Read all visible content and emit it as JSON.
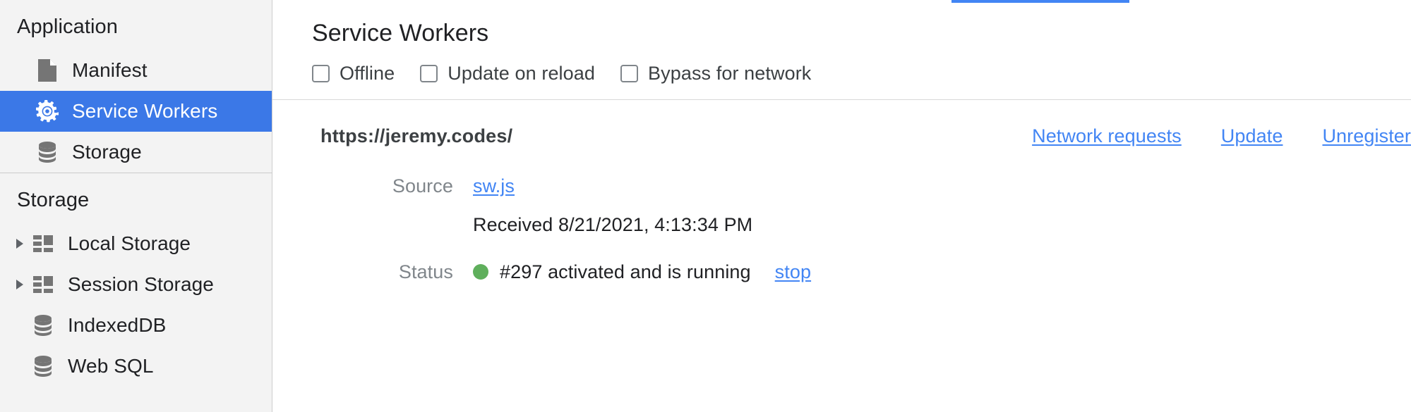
{
  "sidebar": {
    "sections": [
      {
        "heading": "Application",
        "items": [
          {
            "label": "Manifest",
            "icon": "document-icon",
            "selected": false,
            "expandable": false
          },
          {
            "label": "Service Workers",
            "icon": "gear-icon",
            "selected": true,
            "expandable": false
          },
          {
            "label": "Storage",
            "icon": "database-icon",
            "selected": false,
            "expandable": false
          }
        ]
      },
      {
        "heading": "Storage",
        "items": [
          {
            "label": "Local Storage",
            "icon": "table-icon",
            "selected": false,
            "expandable": true
          },
          {
            "label": "Session Storage",
            "icon": "table-icon",
            "selected": false,
            "expandable": true
          },
          {
            "label": "IndexedDB",
            "icon": "database-icon",
            "selected": false,
            "expandable": false
          },
          {
            "label": "Web SQL",
            "icon": "database-icon",
            "selected": false,
            "expandable": false
          }
        ]
      }
    ]
  },
  "panel": {
    "title": "Service Workers",
    "options": [
      {
        "label": "Offline",
        "checked": false
      },
      {
        "label": "Update on reload",
        "checked": false
      },
      {
        "label": "Bypass for network",
        "checked": false
      }
    ],
    "registration": {
      "scope": "https://jeremy.codes/",
      "actions": [
        {
          "label": "Network requests"
        },
        {
          "label": "Update"
        },
        {
          "label": "Unregister"
        }
      ],
      "fields": {
        "source_label": "Source",
        "source_link": "sw.js",
        "received": "Received 8/21/2021, 4:13:34 PM",
        "status_label": "Status",
        "status_text": "#297 activated and is running",
        "status_action": "stop"
      }
    }
  },
  "colors": {
    "accent": "#4285f4",
    "selection": "#3b78e7",
    "status_running": "#5faf5c",
    "sidebar_bg": "#f3f3f3",
    "link": "#4285f4"
  }
}
